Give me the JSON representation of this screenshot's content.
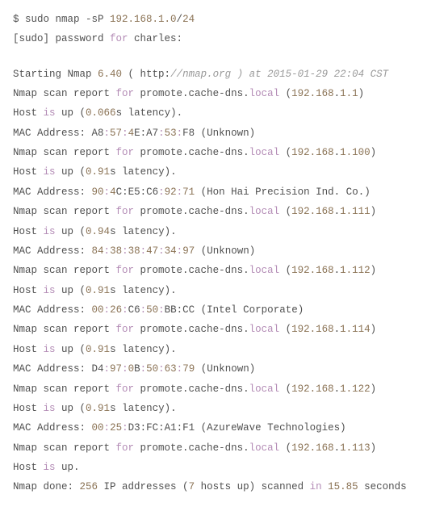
{
  "cmd": {
    "prompt": "$ sudo nmap -sP ",
    "ip": "192.168.1.0",
    "mask": "24"
  },
  "sudo": {
    "prefix": "[sudo] password ",
    "for": "for",
    "user": " charles:"
  },
  "start": {
    "t1": "Starting Nmap ",
    "ver": "6.40",
    "t2": " ( http:",
    "comment": "//nmap.org ) at 2015-01-29 22:04 CST"
  },
  "hosts": [
    {
      "report_pre": "Nmap scan report ",
      "for": "for",
      "host_pre": " promote.cache-dns.",
      "local": "local",
      "ip_o1": "192.168",
      "ip_o2": "1.1",
      "up_pre": "Host ",
      "is": "is",
      "up_mid": " up (",
      "lat": "0.066",
      "lat_unit": "s latency).",
      "mac_pre": "MAC Address: A8:",
      "m1": "57",
      "mc1": ":",
      "m2": "4",
      "mt2": "E:A7:",
      "m3": "53",
      "mc3": ":F8 (Unknown)"
    }
  ],
  "r1": {
    "report_pre": "Nmap scan report ",
    "for": "for",
    "host_pre": " promote.cache-dns.",
    "local": "local",
    "ip1": "192.168",
    "ip2": "1.1",
    "up_pre": "Host ",
    "is": "is",
    "up_mid": " up (",
    "lat": "0.066",
    "lat_unit": "s latency).",
    "mac_a": "MAC Address: A8",
    "m1": "57",
    "m2a": "4",
    "m2b": "E:A7",
    "m3": "53",
    "m4": "F8 (Unknown)"
  },
  "r2": {
    "ip1": "192.168",
    "ip2": "1.100",
    "lat": "0.91",
    "mac_a": "MAC Address: ",
    "m0": "90",
    "m1": "4",
    "m1b": "C:E5:C6",
    "m2": "92",
    "m3": "71",
    "tail": " (Hon Hai Precision Ind. Co.)"
  },
  "r3": {
    "ip1": "192.168",
    "ip2": "1.111",
    "lat": "0.94",
    "mac_a": "MAC Address: ",
    "m0": "84",
    "m1": "38",
    "m2": "38",
    "m3": "47",
    "m4": "34",
    "m5": "97",
    "tail": " (Unknown)"
  },
  "r4": {
    "ip1": "192.168",
    "ip2": "1.112",
    "lat": "0.91",
    "mac_a": "MAC Address: ",
    "m0": "00",
    "m1": "26",
    "m1b": "C6",
    "m2": "50",
    "m2b": "BB:CC",
    "tail": " (Intel Corporate)"
  },
  "r5": {
    "ip1": "192.168",
    "ip2": "1.114",
    "lat": "0.91",
    "mac_a": "MAC Address: D4",
    "m1": "97",
    "m1b": "0",
    "m1c": "B",
    "m2": "50",
    "m3": "63",
    "m4": "79",
    "tail": " (Unknown)"
  },
  "r6": {
    "ip1": "192.168",
    "ip2": "1.122",
    "lat": "0.91",
    "mac_a": "MAC Address: ",
    "m0": "00",
    "m1": "25",
    "m1b": "D3:FC:A1:F1",
    "tail": " (AzureWave Technologies)"
  },
  "r7": {
    "ip1": "192.168",
    "ip2": "1.113",
    "up": "Host ",
    "is": "is",
    "up2": " up."
  },
  "done": {
    "t1": "Nmap done: ",
    "n1": "256",
    "t2": " IP addresses (",
    "n2": "7",
    "t3": " hosts up) scanned ",
    "in": "in",
    "sp": " ",
    "n3": "15.85",
    "t4": " seconds"
  },
  "common": {
    "report_pre": "Nmap scan report ",
    "for": "for",
    "host_pre": " promote.cache-dns.",
    "local": "local",
    "up_pre": "Host ",
    "is": "is",
    "up_mid": " up (",
    "lat_unit": "s latency)."
  }
}
